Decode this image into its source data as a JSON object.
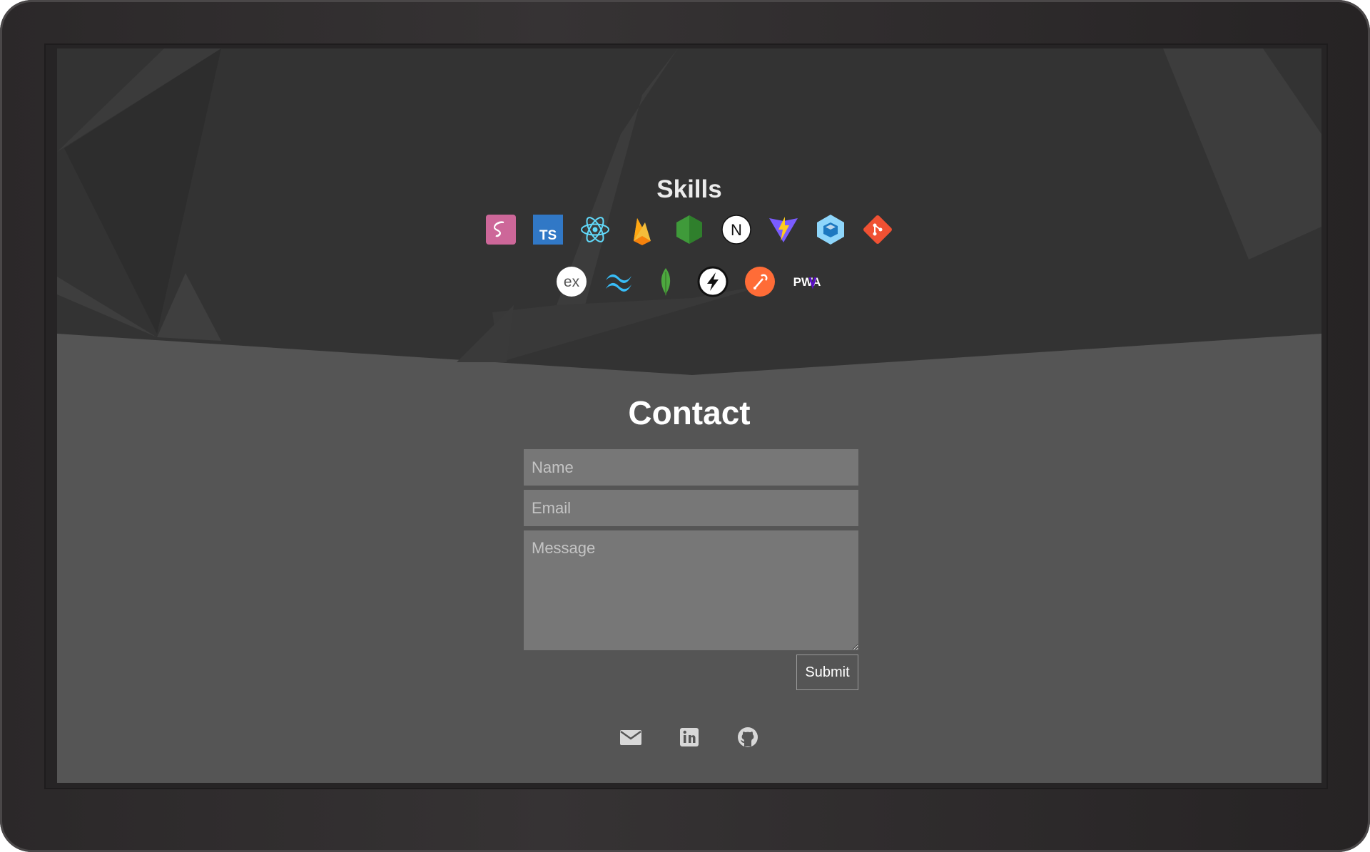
{
  "skills": {
    "title": "Skills",
    "row1": [
      {
        "icon": "sass-icon"
      },
      {
        "icon": "typescript-icon",
        "text": "TS"
      },
      {
        "icon": "react-icon"
      },
      {
        "icon": "firebase-icon"
      },
      {
        "icon": "nodejs-icon"
      },
      {
        "icon": "nextjs-icon",
        "text": "N"
      },
      {
        "icon": "vite-icon"
      },
      {
        "icon": "webpack-icon"
      },
      {
        "icon": "git-icon"
      }
    ],
    "row2": [
      {
        "icon": "express-icon",
        "text": "ex"
      },
      {
        "icon": "tailwind-icon"
      },
      {
        "icon": "mongodb-icon"
      },
      {
        "icon": "socketio-icon"
      },
      {
        "icon": "postman-icon"
      },
      {
        "icon": "pwa-icon",
        "text": "PWA"
      }
    ]
  },
  "contact": {
    "title": "Contact",
    "name_placeholder": "Name",
    "email_placeholder": "Email",
    "message_placeholder": "Message",
    "submit_label": "Submit"
  },
  "social": [
    {
      "icon": "mail-icon"
    },
    {
      "icon": "linkedin-icon"
    },
    {
      "icon": "github-icon"
    }
  ],
  "colors": {
    "skills_bg": "#333333",
    "contact_bg": "#555555",
    "field_bg": "#777777",
    "text": "#ffffff"
  }
}
